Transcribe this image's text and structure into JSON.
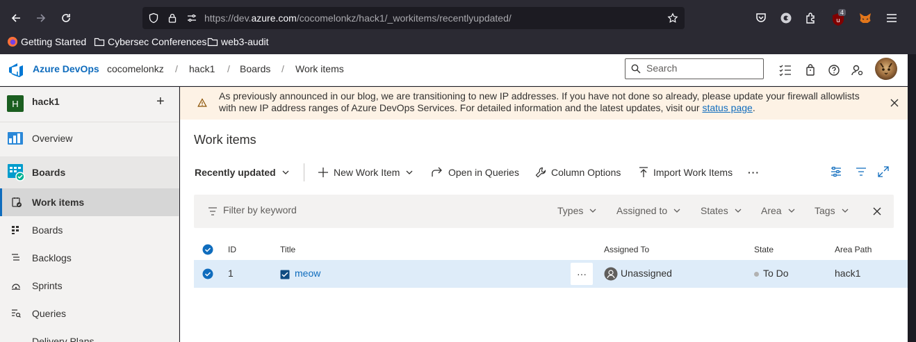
{
  "browser": {
    "url_prefix": "https://dev.",
    "url_domain": "azure.com",
    "url_path": "/cocomelonkz/hack1/_workitems/recentlyupdated/",
    "extension_badge": "4",
    "bookmarks": [
      "Getting Started",
      "Cybersec Conferences",
      "web3-audit"
    ]
  },
  "header": {
    "brand": "Azure DevOps",
    "org": "cocomelonkz",
    "project": "hack1",
    "section": "Boards",
    "page": "Work items",
    "separator": "/",
    "search_placeholder": "Search"
  },
  "sidebar": {
    "project_initial": "H",
    "project_name": "hack1",
    "add_symbol": "+",
    "items": [
      {
        "label": "Overview"
      },
      {
        "label": "Boards"
      },
      {
        "label": "Work items"
      },
      {
        "label": "Boards"
      },
      {
        "label": "Backlogs"
      },
      {
        "label": "Sprints"
      },
      {
        "label": "Queries"
      },
      {
        "label": "Delivery Plans"
      }
    ]
  },
  "banner": {
    "text": "As previously announced in our blog, we are transitioning to new IP addresses. If you have not done so already, please update your firewall allowlists with new IP address ranges of Azure DevOps Services. For detailed information and the latest updates, visit our ",
    "link": "status page",
    "suffix": "."
  },
  "main": {
    "title": "Work items",
    "toolbar": {
      "view": "Recently updated",
      "new_item": "New Work Item",
      "open_queries": "Open in Queries",
      "column_options": "Column Options",
      "import": "Import Work Items",
      "more": "···"
    },
    "filter": {
      "placeholder": "Filter by keyword",
      "types": "Types",
      "assigned_to": "Assigned to",
      "states": "States",
      "area": "Area",
      "tags": "Tags"
    },
    "columns": [
      "ID",
      "Title",
      "Assigned To",
      "State",
      "Area Path"
    ],
    "rows": [
      {
        "id": "1",
        "title": "meow",
        "more": "···",
        "assigned": "Unassigned",
        "state": "To Do",
        "area": "hack1"
      }
    ]
  },
  "colors": {
    "accent": "#0f6cbd",
    "banner_bg": "#fdf2e5",
    "selected_row": "#deecf9",
    "project_avatar": "#1b5e20"
  }
}
